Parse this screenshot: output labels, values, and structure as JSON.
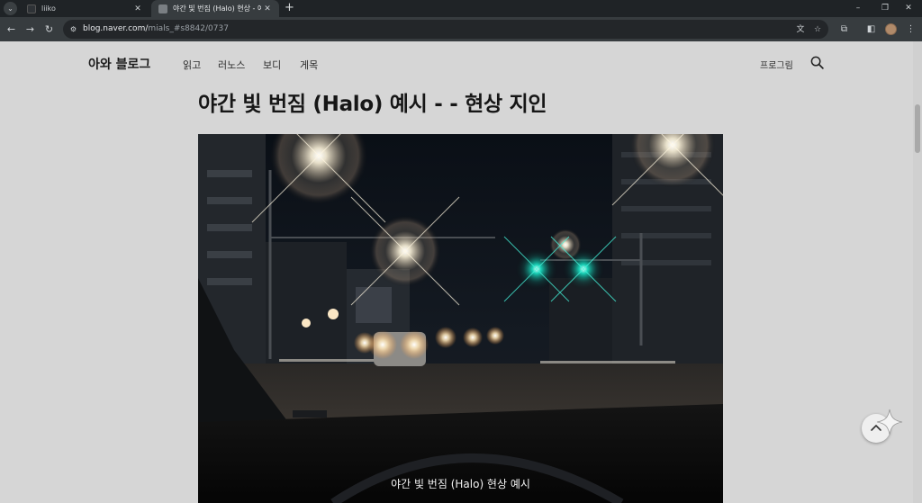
{
  "browser": {
    "tabs": [
      {
        "title": "liiko",
        "close": "✕"
      },
      {
        "title": "야간 빛 번짐 (Halo) 현상 - 예시",
        "close": "✕"
      }
    ],
    "new_tab": "+",
    "url_host": "blog.naver.com/",
    "url_path": "mials_#s8842/0737",
    "window_controls": {
      "minimize": "–",
      "restore": "❐",
      "close": "✕"
    }
  },
  "site": {
    "brand": "아와 블로그",
    "nav": [
      "읽고",
      "러노스",
      "보디",
      "게목"
    ],
    "right_link": "프로그림"
  },
  "post": {
    "title": "야간 빛 번짐 (Halo) 예시 - - 현상 지인",
    "image_caption": "야간 빛 번짐 (Halo) 현상 예시"
  },
  "icons": {
    "tab_list": "chevron-down-icon",
    "back": "back-arrow-icon",
    "forward": "forward-arrow-icon",
    "reload": "reload-icon",
    "site_info": "site-info-icon",
    "translate": "translate-icon",
    "bookmark": "star-icon",
    "extensions": "puzzle-icon",
    "side_panel": "side-panel-icon",
    "menu": "kebab-menu-icon",
    "search": "search-icon",
    "scroll_top": "chevron-up-icon",
    "assistant": "sparkle-icon"
  },
  "colors": {
    "page_bg": "#d6d6d6",
    "chrome_dark": "#1f2326",
    "toolbar": "#373c3f",
    "traffic_green": "#19e6c8"
  }
}
